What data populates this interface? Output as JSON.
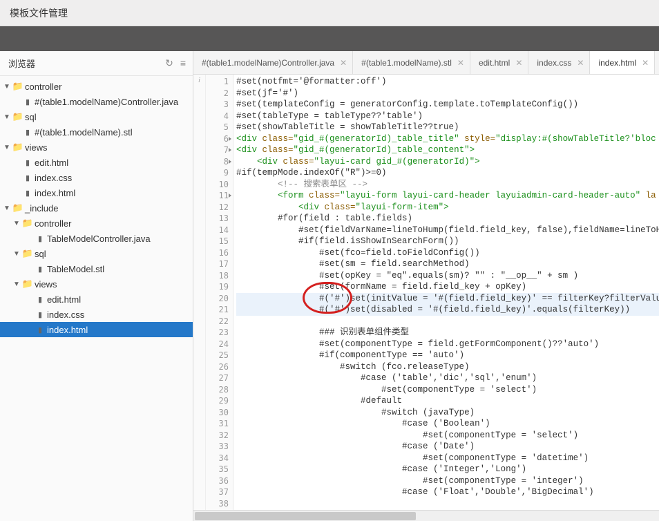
{
  "titlebar": "模板文件管理",
  "sidebar": {
    "title": "浏览器",
    "refresh_icon": "↻",
    "menu_icon": "≡",
    "tree": [
      {
        "lvl": 0,
        "type": "folder",
        "expand": "▼",
        "label": "controller"
      },
      {
        "lvl": 1,
        "type": "file",
        "label": "#(table1.modelName)Controller.java"
      },
      {
        "lvl": 0,
        "type": "folder",
        "expand": "▼",
        "label": "sql"
      },
      {
        "lvl": 1,
        "type": "file",
        "label": "#(table1.modelName).stl"
      },
      {
        "lvl": 0,
        "type": "folder",
        "expand": "▼",
        "label": "views"
      },
      {
        "lvl": 1,
        "type": "file",
        "label": "edit.html"
      },
      {
        "lvl": 1,
        "type": "file",
        "label": "index.css"
      },
      {
        "lvl": 1,
        "type": "file",
        "label": "index.html"
      },
      {
        "lvl": 0,
        "type": "folder",
        "expand": "▼",
        "label": "_include"
      },
      {
        "lvl": 1,
        "type": "folder",
        "expand": "▼",
        "label": "controller"
      },
      {
        "lvl": 2,
        "type": "file",
        "label": "TableModelController.java"
      },
      {
        "lvl": 1,
        "type": "folder",
        "expand": "▼",
        "label": "sql"
      },
      {
        "lvl": 2,
        "type": "file",
        "label": "TableModel.stl"
      },
      {
        "lvl": 1,
        "type": "folder",
        "expand": "▼",
        "label": "views"
      },
      {
        "lvl": 2,
        "type": "file",
        "label": "edit.html"
      },
      {
        "lvl": 2,
        "type": "file",
        "label": "index.css"
      },
      {
        "lvl": 2,
        "type": "file",
        "label": "index.html",
        "selected": true
      }
    ]
  },
  "tabs": [
    {
      "label": "#(table1.modelName)Controller.java"
    },
    {
      "label": "#(table1.modelName).stl"
    },
    {
      "label": "edit.html"
    },
    {
      "label": "index.css"
    },
    {
      "label": "index.html",
      "active": true
    }
  ],
  "info_char": "i",
  "code": {
    "highlight_lines": [
      20,
      21
    ],
    "folded_lines": [
      6,
      7,
      8,
      11
    ],
    "lines": [
      {
        "n": 1,
        "html": "<span class='k-txt'>#set(notfmt='@formatter:off')</span>"
      },
      {
        "n": 2,
        "html": "<span class='k-txt'>#set(jf='#')</span>"
      },
      {
        "n": 3,
        "html": "<span class='k-txt'>#set(templateConfig = generatorConfig.template.toTemplateConfig())</span>"
      },
      {
        "n": 4,
        "html": "<span class='k-txt'>#set(tableType = tableType??'table')</span>"
      },
      {
        "n": 5,
        "html": "<span class='k-txt'>#set(showTableTitle = showTableTitle??true)</span>"
      },
      {
        "n": 6,
        "html": "<span class='k-tag'>&lt;div </span><span class='k-attr'>class=</span><span class='k-str'>\"gid_#(generatorId)_table_title\"</span><span class='k-attr'> style=</span><span class='k-str'>\"display:#(showTableTitle?'bloc</span>"
      },
      {
        "n": 7,
        "html": "<span class='k-tag'>&lt;div </span><span class='k-attr'>class=</span><span class='k-str'>\"gid_#(generatorId)_table_content\"</span><span class='k-tag'>&gt;</span>"
      },
      {
        "n": 8,
        "html": "    <span class='k-tag'>&lt;div </span><span class='k-attr'>class=</span><span class='k-str'>\"layui-card gid_#(generatorId)\"</span><span class='k-tag'>&gt;</span>"
      },
      {
        "n": 9,
        "html": "<span class='k-txt'>#if(tempMode.indexOf(\"R\")&gt;=0)</span>"
      },
      {
        "n": 10,
        "html": "        <span class='k-cmt'>&lt;!-- 搜索表单区 --&gt;</span>"
      },
      {
        "n": 11,
        "html": "        <span class='k-tag'>&lt;form </span><span class='k-attr'>class=</span><span class='k-str'>\"layui-form layui-card-header layuiadmin-card-header-auto\"</span><span class='k-attr'> la</span>"
      },
      {
        "n": 12,
        "html": "            <span class='k-tag'>&lt;div </span><span class='k-attr'>class=</span><span class='k-str'>\"layui-form-item\"</span><span class='k-tag'>&gt;</span>"
      },
      {
        "n": 13,
        "html": "        <span class='k-txt'>#for(field : table.fields)</span>"
      },
      {
        "n": 14,
        "html": "            <span class='k-txt'>#set(fieldVarName=lineToHump(field.field_key, false),fieldName=lineToHump</span>"
      },
      {
        "n": 15,
        "html": "            <span class='k-txt'>#if(field.isShowInSearchForm())</span>"
      },
      {
        "n": 16,
        "html": "                <span class='k-txt'>#set(fco=field.toFieldConfig())</span>"
      },
      {
        "n": 17,
        "html": "                <span class='k-txt'>#set(sm = field.searchMethod)</span>"
      },
      {
        "n": 18,
        "html": "                <span class='k-txt'>#set(opKey = \"eq\".equals(sm)? \"\" : \"__op__\" + sm )</span>"
      },
      {
        "n": 19,
        "html": "                <span class='k-txt'>#set(formName = field.field_key + opKey)</span>"
      },
      {
        "n": 20,
        "html": "                <span class='k-txt'>#('#')set(initValue = '#(field.field_key)' == filterKey?filterValue:'</span>"
      },
      {
        "n": 21,
        "html": "                <span class='k-txt'>#('#')set(disabled = '#(field.field_key)'.equals(filterKey))</span>"
      },
      {
        "n": 22,
        "html": ""
      },
      {
        "n": 23,
        "html": "                <span class='k-txt'>### 识别表单组件类型</span>"
      },
      {
        "n": 24,
        "html": "                <span class='k-txt'>#set(componentType = field.getFormComponent()??'auto')</span>"
      },
      {
        "n": 25,
        "html": "                <span class='k-txt'>#if(componentType == 'auto')</span>"
      },
      {
        "n": 26,
        "html": "                    <span class='k-txt'>#switch (fco.releaseType)</span>"
      },
      {
        "n": 27,
        "html": "                        <span class='k-txt'>#case ('table','dic','sql','enum')</span>"
      },
      {
        "n": 28,
        "html": "                            <span class='k-txt'>#set(componentType = 'select')</span>"
      },
      {
        "n": 29,
        "html": "                        <span class='k-txt'>#default</span>"
      },
      {
        "n": 30,
        "html": "                            <span class='k-txt'>#switch (javaType)</span>"
      },
      {
        "n": 31,
        "html": "                                <span class='k-txt'>#case ('Boolean')</span>"
      },
      {
        "n": 32,
        "html": "                                    <span class='k-txt'>#set(componentType = 'select')</span>"
      },
      {
        "n": 33,
        "html": "                                <span class='k-txt'>#case ('Date')</span>"
      },
      {
        "n": 34,
        "html": "                                    <span class='k-txt'>#set(componentType = 'datetime')</span>"
      },
      {
        "n": 35,
        "html": "                                <span class='k-txt'>#case ('Integer','Long')</span>"
      },
      {
        "n": 36,
        "html": "                                    <span class='k-txt'>#set(componentType = 'integer')</span>"
      },
      {
        "n": 37,
        "html": "                                <span class='k-txt'>#case ('Float','Double','BigDecimal')</span>"
      },
      {
        "n": 38,
        "html": ""
      }
    ]
  },
  "annotation": {
    "circle_line": 20
  }
}
